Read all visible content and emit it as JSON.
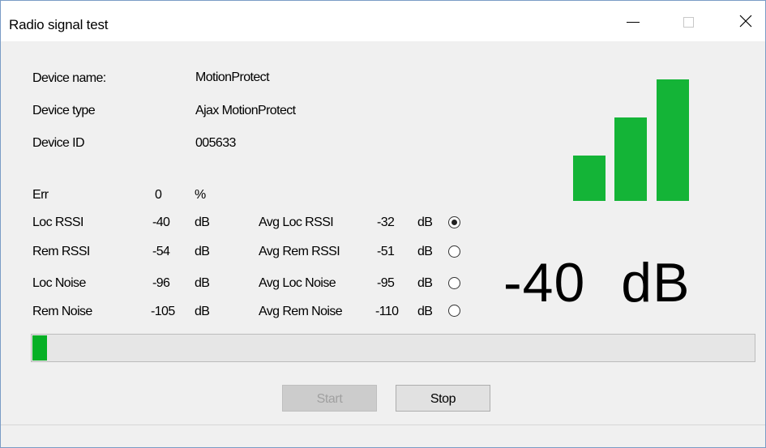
{
  "window": {
    "title": "Radio signal test",
    "minimize_icon": "minimize-icon",
    "maximize_icon": "maximize-icon",
    "close_icon": "close-icon"
  },
  "device": {
    "name_label": "Device name:",
    "name_value": "MotionProtect",
    "type_label": "Device type",
    "type_value": "Ajax MotionProtect",
    "id_label": "Device ID",
    "id_value": "005633"
  },
  "err": {
    "label": "Err",
    "value": "0",
    "unit": "%"
  },
  "metrics": [
    {
      "label": "Loc RSSI",
      "value": "-40",
      "unit": "dB",
      "avg_label": "Avg Loc RSSI",
      "avg_value": "-32",
      "avg_unit": "dB",
      "selected": true
    },
    {
      "label": "Rem RSSI",
      "value": "-54",
      "unit": "dB",
      "avg_label": "Avg Rem RSSI",
      "avg_value": "-51",
      "avg_unit": "dB",
      "selected": false
    },
    {
      "label": "Loc Noise",
      "value": "-96",
      "unit": "dB",
      "avg_label": "Avg Loc Noise",
      "avg_value": "-95",
      "avg_unit": "dB",
      "selected": false
    },
    {
      "label": "Rem Noise",
      "value": "-105",
      "unit": "dB",
      "avg_label": "Avg Rem Noise",
      "avg_value": "-110",
      "avg_unit": "dB",
      "selected": false
    }
  ],
  "signal": {
    "value": "-40",
    "unit": "dB",
    "bars_total": 3,
    "bars_active": 3,
    "color": "#14b437"
  },
  "progress": {
    "fraction": 0.02,
    "color": "#06b025"
  },
  "buttons": {
    "start_label": "Start",
    "start_enabled": false,
    "stop_label": "Stop"
  }
}
